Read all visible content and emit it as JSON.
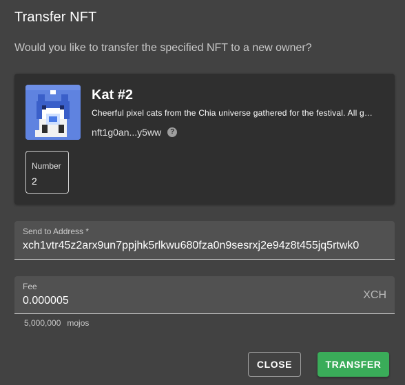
{
  "dialog": {
    "title": "Transfer NFT",
    "description": "Would you like to transfer the specified NFT to a new owner?"
  },
  "nft": {
    "name": "Kat #2",
    "description": "Cheerful pixel cats from the Chia universe gathered for the festival. All g…",
    "id_short": "nft1g0an...y5ww",
    "help_icon": "question-circle-icon",
    "number_label": "Number",
    "number_value": "2",
    "thumbnail_bg": "#5f83e0"
  },
  "address_field": {
    "label": "Send to Address *",
    "value": "xch1vtr45z2arx9un7ppjhk5rlkwu680fza0n9sesrxj2e94z8t455jq5rtwk0"
  },
  "fee_field": {
    "label": "Fee",
    "value": "0.000005",
    "suffix": "XCH",
    "helper_amount": "5,000,000",
    "helper_unit": "mojos"
  },
  "actions": {
    "close_label": "CLOSE",
    "transfer_label": "TRANSFER"
  },
  "colors": {
    "background": "#424242",
    "card": "#2f2f2f",
    "field": "#515151",
    "accent": "#3aac59"
  }
}
